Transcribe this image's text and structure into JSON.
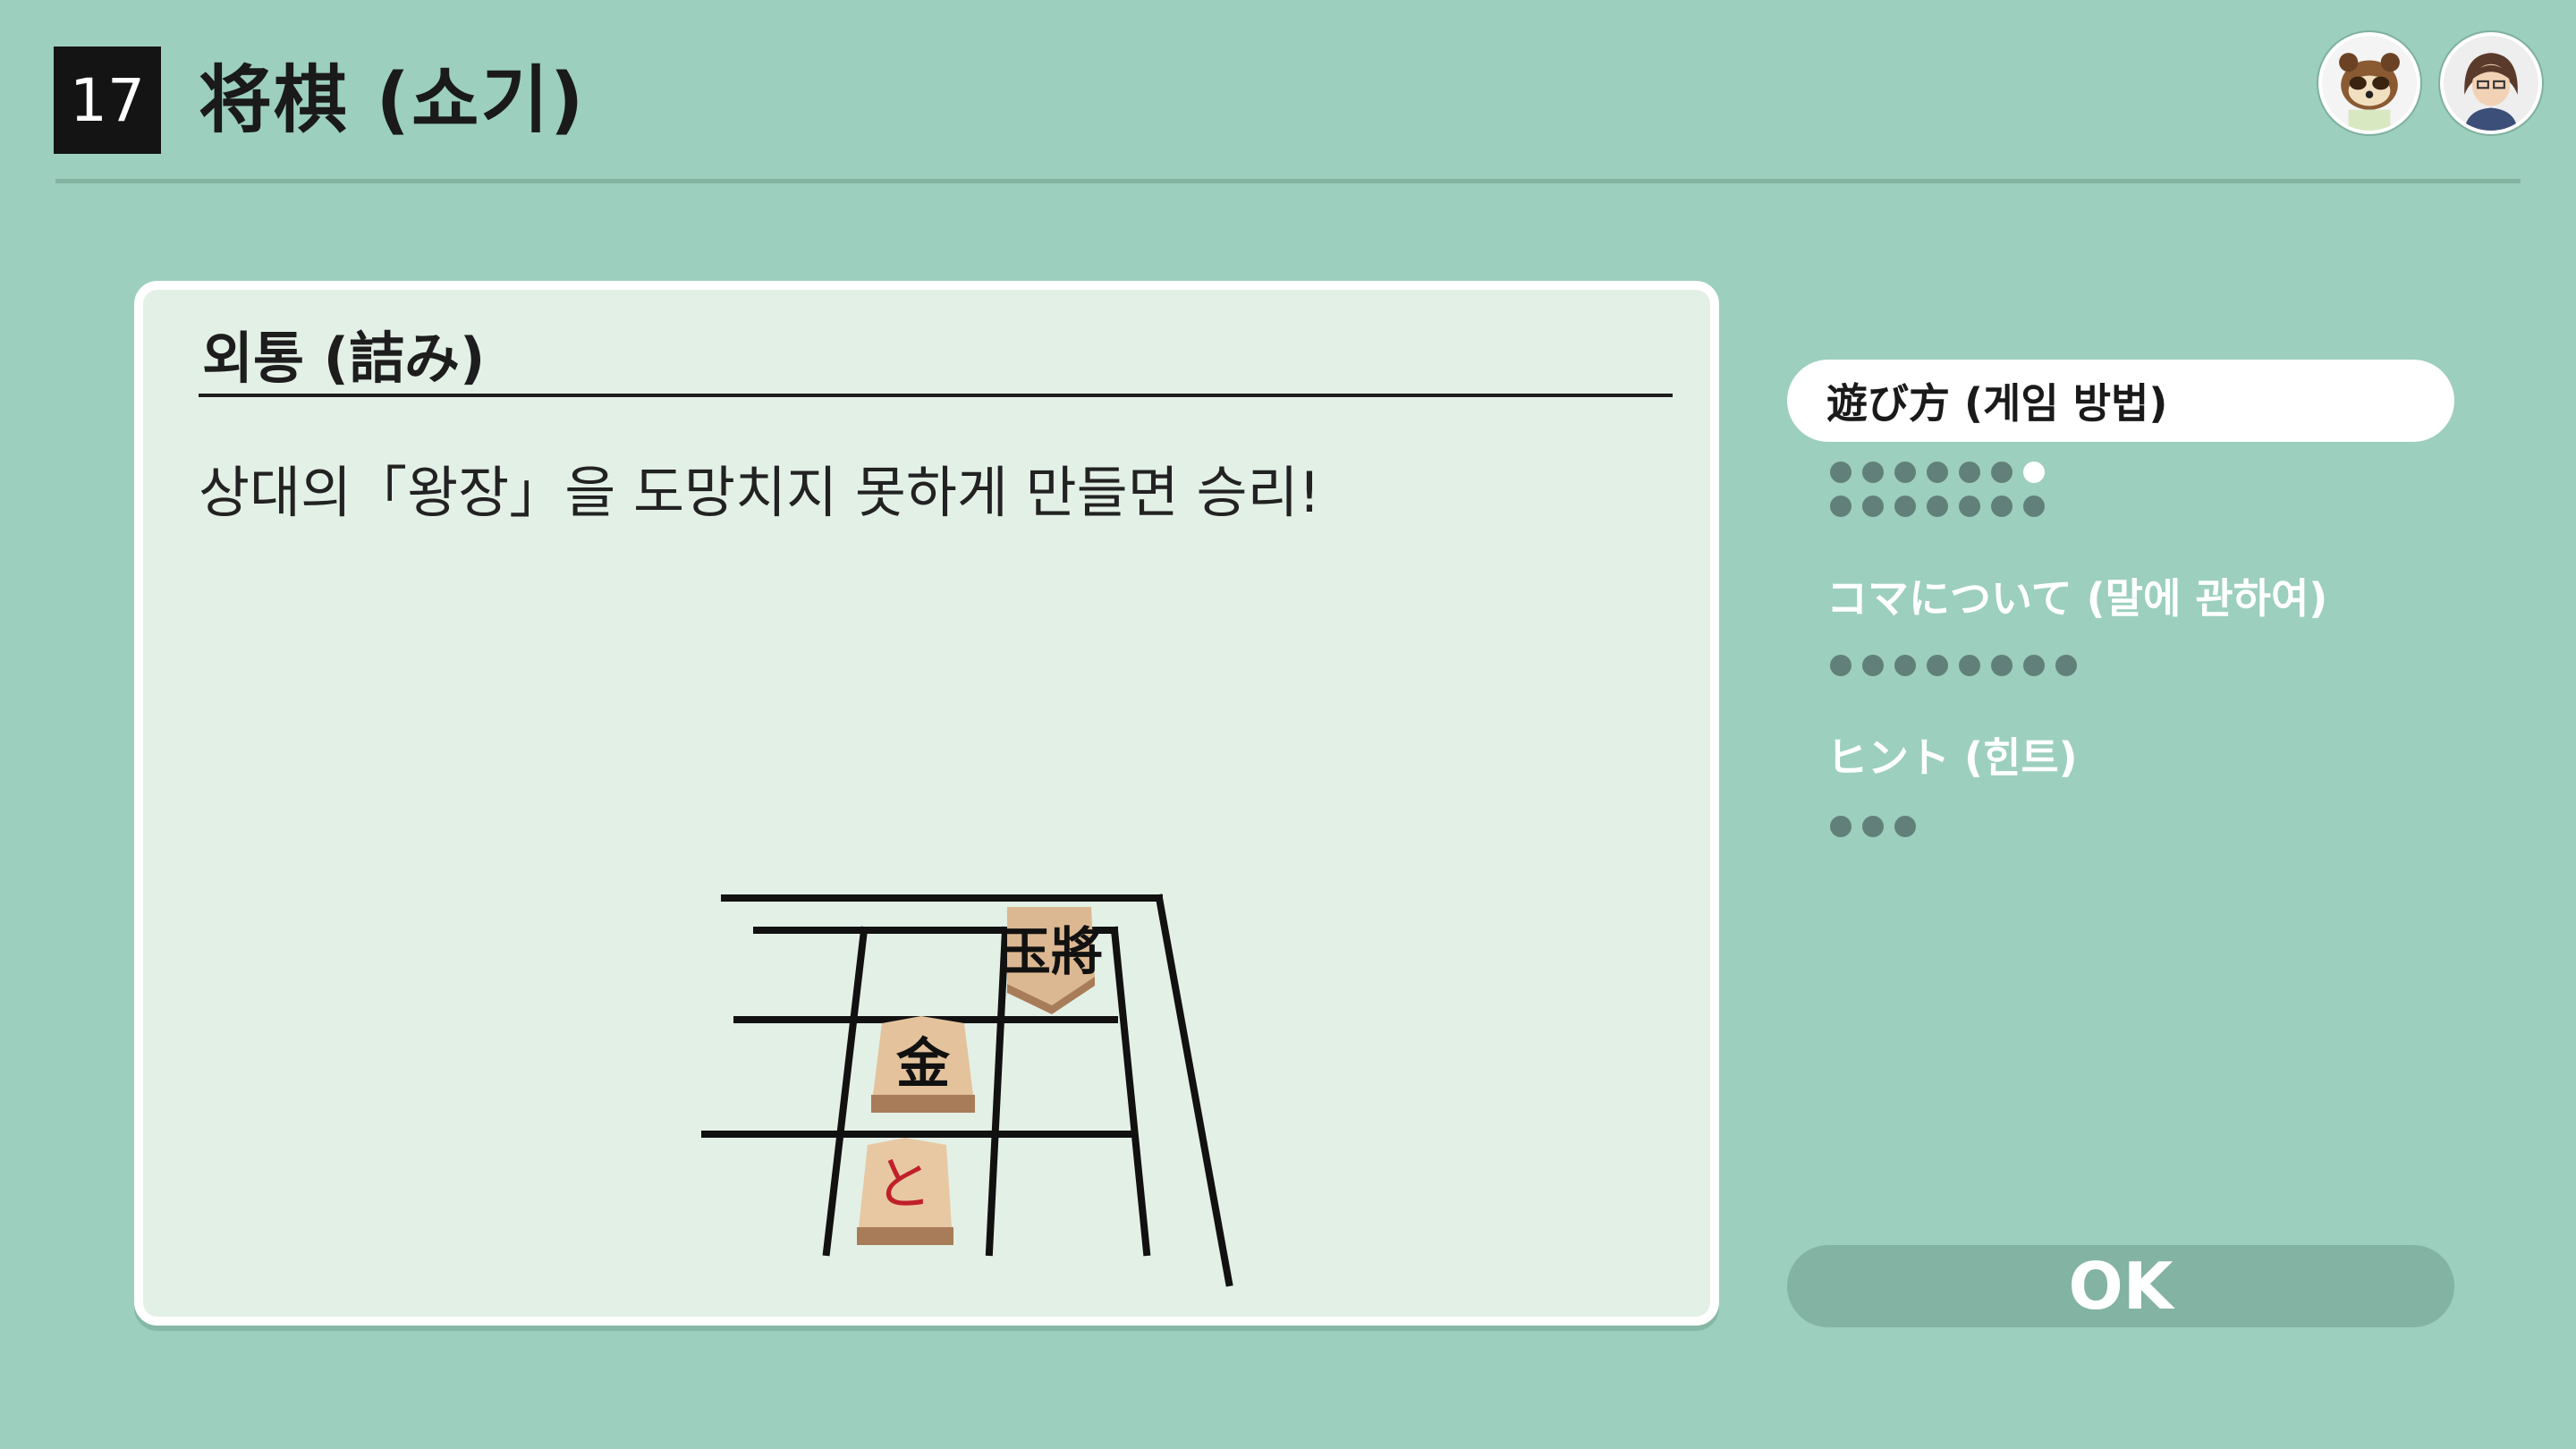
{
  "header": {
    "number": "17",
    "title": "将棋 (쇼기)"
  },
  "avatars": [
    {
      "name": "raccoon-avatar"
    },
    {
      "name": "user-avatar"
    }
  ],
  "panel": {
    "title": "외통 (詰み)",
    "description": "상대의「왕장」을 도망치지 못하게 만들면 승리!",
    "pieces": [
      {
        "label": "玉將",
        "color": "#111111"
      },
      {
        "label": "金",
        "color": "#111111"
      },
      {
        "label": "と",
        "color": "#c0202a"
      }
    ]
  },
  "menu": {
    "items": [
      {
        "label": "遊び方 (게임 방법)",
        "selected": true,
        "pages": 15,
        "current": 7
      },
      {
        "label": "コマについて (말에 관하여)",
        "selected": false,
        "pages": 8
      },
      {
        "label": "ヒント (힌트)",
        "selected": false,
        "pages": 3
      }
    ]
  },
  "ok_label": "OK",
  "colors": {
    "background": "#9ccfbd",
    "panel": "#e3f0e6",
    "dot": "#62807a",
    "ok_button": "#83b3a2"
  }
}
